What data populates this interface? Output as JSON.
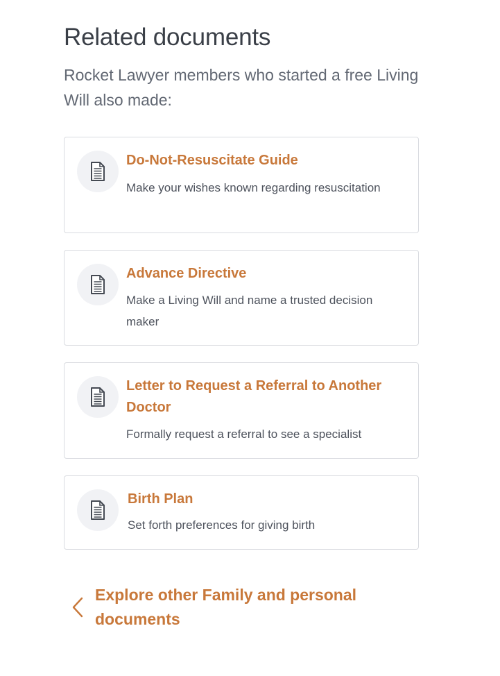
{
  "related": {
    "heading": "Related documents",
    "intro": "Rocket Lawyer members who started a free Living Will also made:",
    "items": [
      {
        "title": "Do-Not-Resuscitate Guide",
        "description": "Make your wishes known regarding resuscitation",
        "icon": "document-icon"
      },
      {
        "title": "Advance Directive",
        "description": "Make a Living Will and name a trusted decision maker",
        "icon": "document-icon"
      },
      {
        "title": "Letter to Request a Referral to Another Doctor",
        "description": "Formally request a referral to see a specialist",
        "icon": "document-icon"
      },
      {
        "title": "Birth Plan",
        "description": "Set forth preferences for giving birth",
        "icon": "document-icon"
      }
    ]
  },
  "explore": {
    "label": "Explore other Family and personal documents",
    "icon": "chevron-left-icon"
  },
  "colors": {
    "accent": "#c8783a",
    "heading": "#3a3f47",
    "body_text": "#4d525c",
    "border": "#d9dbe0",
    "icon_bg": "#f1f2f5"
  }
}
